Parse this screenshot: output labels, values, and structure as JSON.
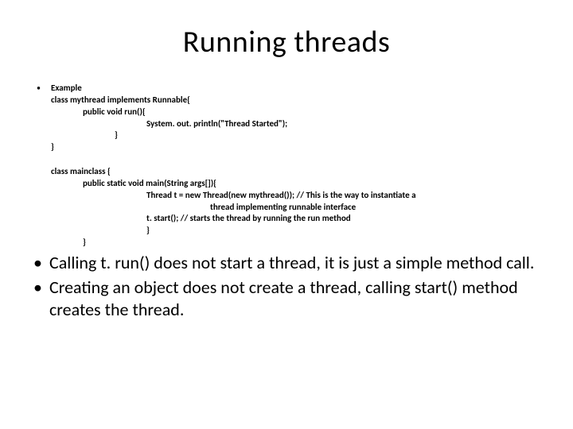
{
  "title": "Running threads",
  "example": {
    "label": "Example",
    "l1": "class mythread implements Runnable{",
    "l2": "public void run(){",
    "l3": "System. out. println(\"Thread Started\");",
    "l4": "}",
    "l5": "}",
    "m1": "class mainclass {",
    "m2": "public static void main(String args[]){",
    "m3": "Thread  t = new Thread(new mythread()); // This is the way to instantiate a",
    "m3b": "thread implementing runnable interface",
    "m4": "t. start(); // starts the thread by running the run method",
    "m5": "}",
    "m6": "}"
  },
  "notes": {
    "n1": "Calling t. run() does not start a thread, it is just a simple method call.",
    "n2": "Creating an object does not create a thread, calling start() method creates the thread."
  }
}
